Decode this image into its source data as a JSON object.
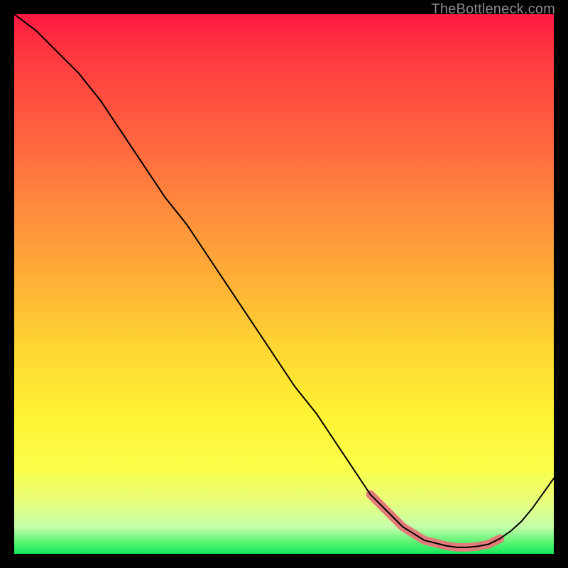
{
  "watermark": "TheBottleneck.com",
  "chart_data": {
    "type": "line",
    "title": "",
    "xlabel": "",
    "ylabel": "",
    "xlim": [
      0,
      100
    ],
    "ylim": [
      0,
      100
    ],
    "grid": false,
    "legend": false,
    "background": "rainbow-gradient",
    "series": [
      {
        "name": "curve",
        "x": [
          0,
          4,
          8,
          12,
          16,
          20,
          24,
          28,
          32,
          36,
          40,
          44,
          48,
          52,
          56,
          60,
          64,
          66,
          68,
          72,
          76,
          80,
          82,
          84,
          86,
          88,
          90,
          92,
          94,
          96,
          98,
          100
        ],
        "y": [
          100,
          97,
          93,
          89,
          84,
          78,
          72,
          66,
          61,
          55,
          49,
          43,
          37,
          31,
          26,
          20,
          14,
          11,
          9,
          5,
          2.5,
          1.5,
          1.2,
          1.2,
          1.4,
          1.8,
          2.8,
          4.2,
          6.0,
          8.4,
          11.2,
          14
        ]
      }
    ],
    "highlight_band": {
      "x_start": 66,
      "x_end": 90
    }
  }
}
